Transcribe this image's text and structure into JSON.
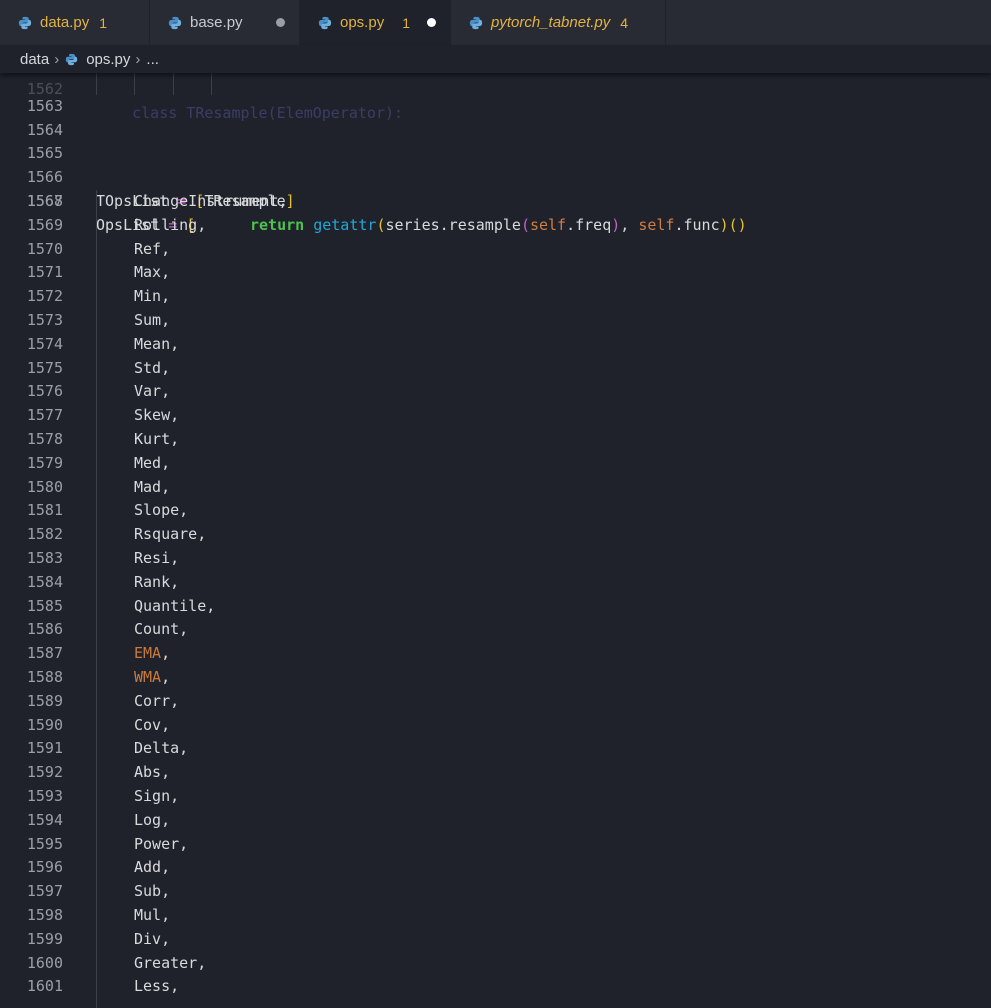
{
  "tabs": [
    {
      "name": "data.py",
      "badge": "1",
      "status": "",
      "active": false
    },
    {
      "name": "base.py",
      "badge": "",
      "status": "modified-dot",
      "active": false
    },
    {
      "name": "ops.py",
      "badge": "1",
      "status": "unsaved-dot",
      "active": true
    },
    {
      "name": "pytorch_tabnet.py",
      "badge": "4",
      "status": "",
      "active": false
    }
  ],
  "breadcrumb": {
    "folder": "data",
    "file": "ops.py",
    "more": "..."
  },
  "editor": {
    "partial_top_line": {
      "number": "1562",
      "text": "    class TResample(ElemOperator):"
    },
    "return_line": {
      "number": "1563",
      "keyword": "return",
      "func": "getattr",
      "open": "(",
      "obj": "series.resample",
      "open2": "(",
      "self1": "self",
      "attr1": ".freq",
      "close2": ")",
      "comma": ", ",
      "self2": "self",
      "attr2": ".func",
      "close": ")",
      "call": "()"
    },
    "blank_lines": [
      "1564",
      "1565"
    ],
    "topslist_line": {
      "number": "1566",
      "name": "TOpsList",
      "eq": " = ",
      "open": "[",
      "item": "TResample",
      "close": "]"
    },
    "opslist_line": {
      "number": "1567",
      "name": "OpsList",
      "eq": " = ",
      "open": "["
    },
    "items": [
      {
        "number": "1568",
        "name": "ChangeInstrument",
        "highlight": false
      },
      {
        "number": "1569",
        "name": "Rolling",
        "highlight": false
      },
      {
        "number": "1570",
        "name": "Ref",
        "highlight": false
      },
      {
        "number": "1571",
        "name": "Max",
        "highlight": false
      },
      {
        "number": "1572",
        "name": "Min",
        "highlight": false
      },
      {
        "number": "1573",
        "name": "Sum",
        "highlight": false
      },
      {
        "number": "1574",
        "name": "Mean",
        "highlight": false
      },
      {
        "number": "1575",
        "name": "Std",
        "highlight": false
      },
      {
        "number": "1576",
        "name": "Var",
        "highlight": false
      },
      {
        "number": "1577",
        "name": "Skew",
        "highlight": false
      },
      {
        "number": "1578",
        "name": "Kurt",
        "highlight": false
      },
      {
        "number": "1579",
        "name": "Med",
        "highlight": false
      },
      {
        "number": "1580",
        "name": "Mad",
        "highlight": false
      },
      {
        "number": "1581",
        "name": "Slope",
        "highlight": false
      },
      {
        "number": "1582",
        "name": "Rsquare",
        "highlight": false
      },
      {
        "number": "1583",
        "name": "Resi",
        "highlight": false
      },
      {
        "number": "1584",
        "name": "Rank",
        "highlight": false
      },
      {
        "number": "1585",
        "name": "Quantile",
        "highlight": false
      },
      {
        "number": "1586",
        "name": "Count",
        "highlight": false
      },
      {
        "number": "1587",
        "name": "EMA",
        "highlight": true
      },
      {
        "number": "1588",
        "name": "WMA",
        "highlight": true
      },
      {
        "number": "1589",
        "name": "Corr",
        "highlight": false
      },
      {
        "number": "1590",
        "name": "Cov",
        "highlight": false
      },
      {
        "number": "1591",
        "name": "Delta",
        "highlight": false
      },
      {
        "number": "1592",
        "name": "Abs",
        "highlight": false
      },
      {
        "number": "1593",
        "name": "Sign",
        "highlight": false
      },
      {
        "number": "1594",
        "name": "Log",
        "highlight": false
      },
      {
        "number": "1595",
        "name": "Power",
        "highlight": false
      },
      {
        "number": "1596",
        "name": "Add",
        "highlight": false
      },
      {
        "number": "1597",
        "name": "Sub",
        "highlight": false
      },
      {
        "number": "1598",
        "name": "Mul",
        "highlight": false
      },
      {
        "number": "1599",
        "name": "Div",
        "highlight": false
      },
      {
        "number": "1600",
        "name": "Greater",
        "highlight": false
      },
      {
        "number": "1601",
        "name": "Less",
        "highlight": false
      }
    ]
  },
  "colors": {
    "background": "#1f222b",
    "tab_text": "#e3b341",
    "keyword": "#4ec24e",
    "function": "#22a8d6",
    "bracket": "#e8c12e",
    "highlight_name": "#c97a3d"
  }
}
